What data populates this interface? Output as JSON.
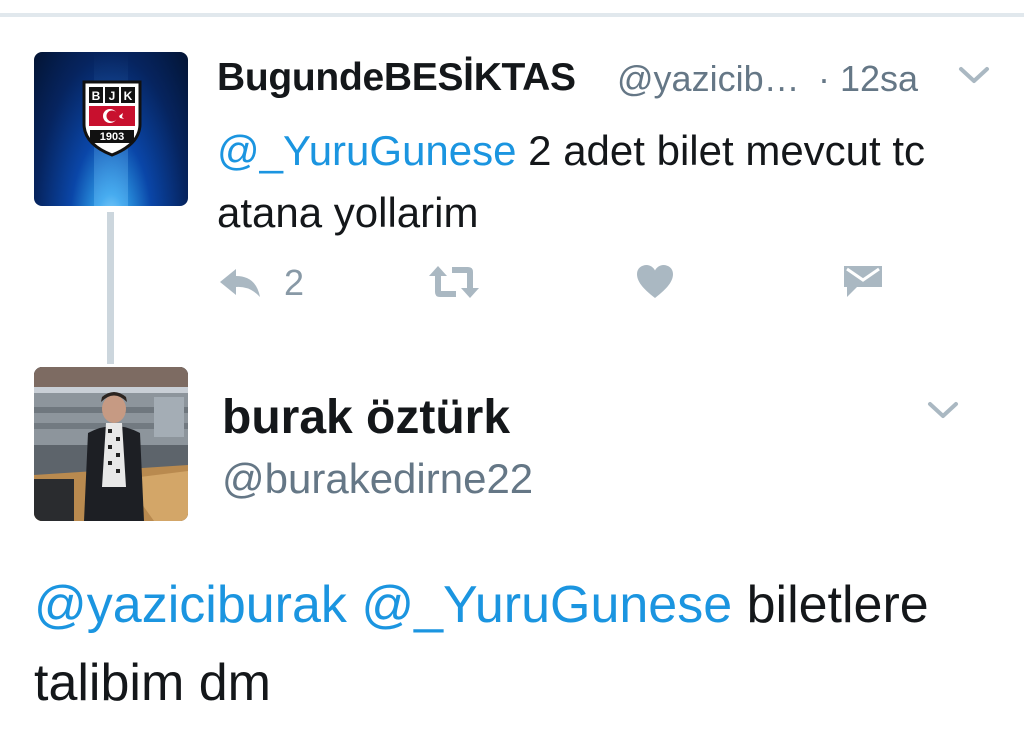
{
  "tweet1": {
    "display_name": "BugundeBESİKTAS",
    "handle": "@yazicib…",
    "separator": "·",
    "time": "12sa",
    "text": {
      "mention": "@_YuruGunese",
      "body": " 2 adet bilet mevcut tc atana yollarim"
    },
    "actions": {
      "reply_icon": "reply-icon",
      "reply_count": "2",
      "retweet_icon": "retweet-icon",
      "like_icon": "heart-icon",
      "dm_icon": "envelope-icon"
    },
    "avatar": {
      "badge_letters": "BJK",
      "badge_year": "1903",
      "colors": {
        "glow": "#2f9ee8",
        "deep": "#06245f"
      }
    }
  },
  "tweet2": {
    "display_name": "burak öztürk",
    "handle": "@burakedirne22",
    "text": {
      "mention1": "@yaziciburak",
      "mention2": "@_YuruGunese",
      "body": " biletlere talibim dm"
    }
  },
  "colors": {
    "link": "#1b95e0",
    "secondary_text": "#657786",
    "icon": "#aab8c2",
    "thread_line": "#ccd6dd",
    "primary_text": "#14171a"
  }
}
